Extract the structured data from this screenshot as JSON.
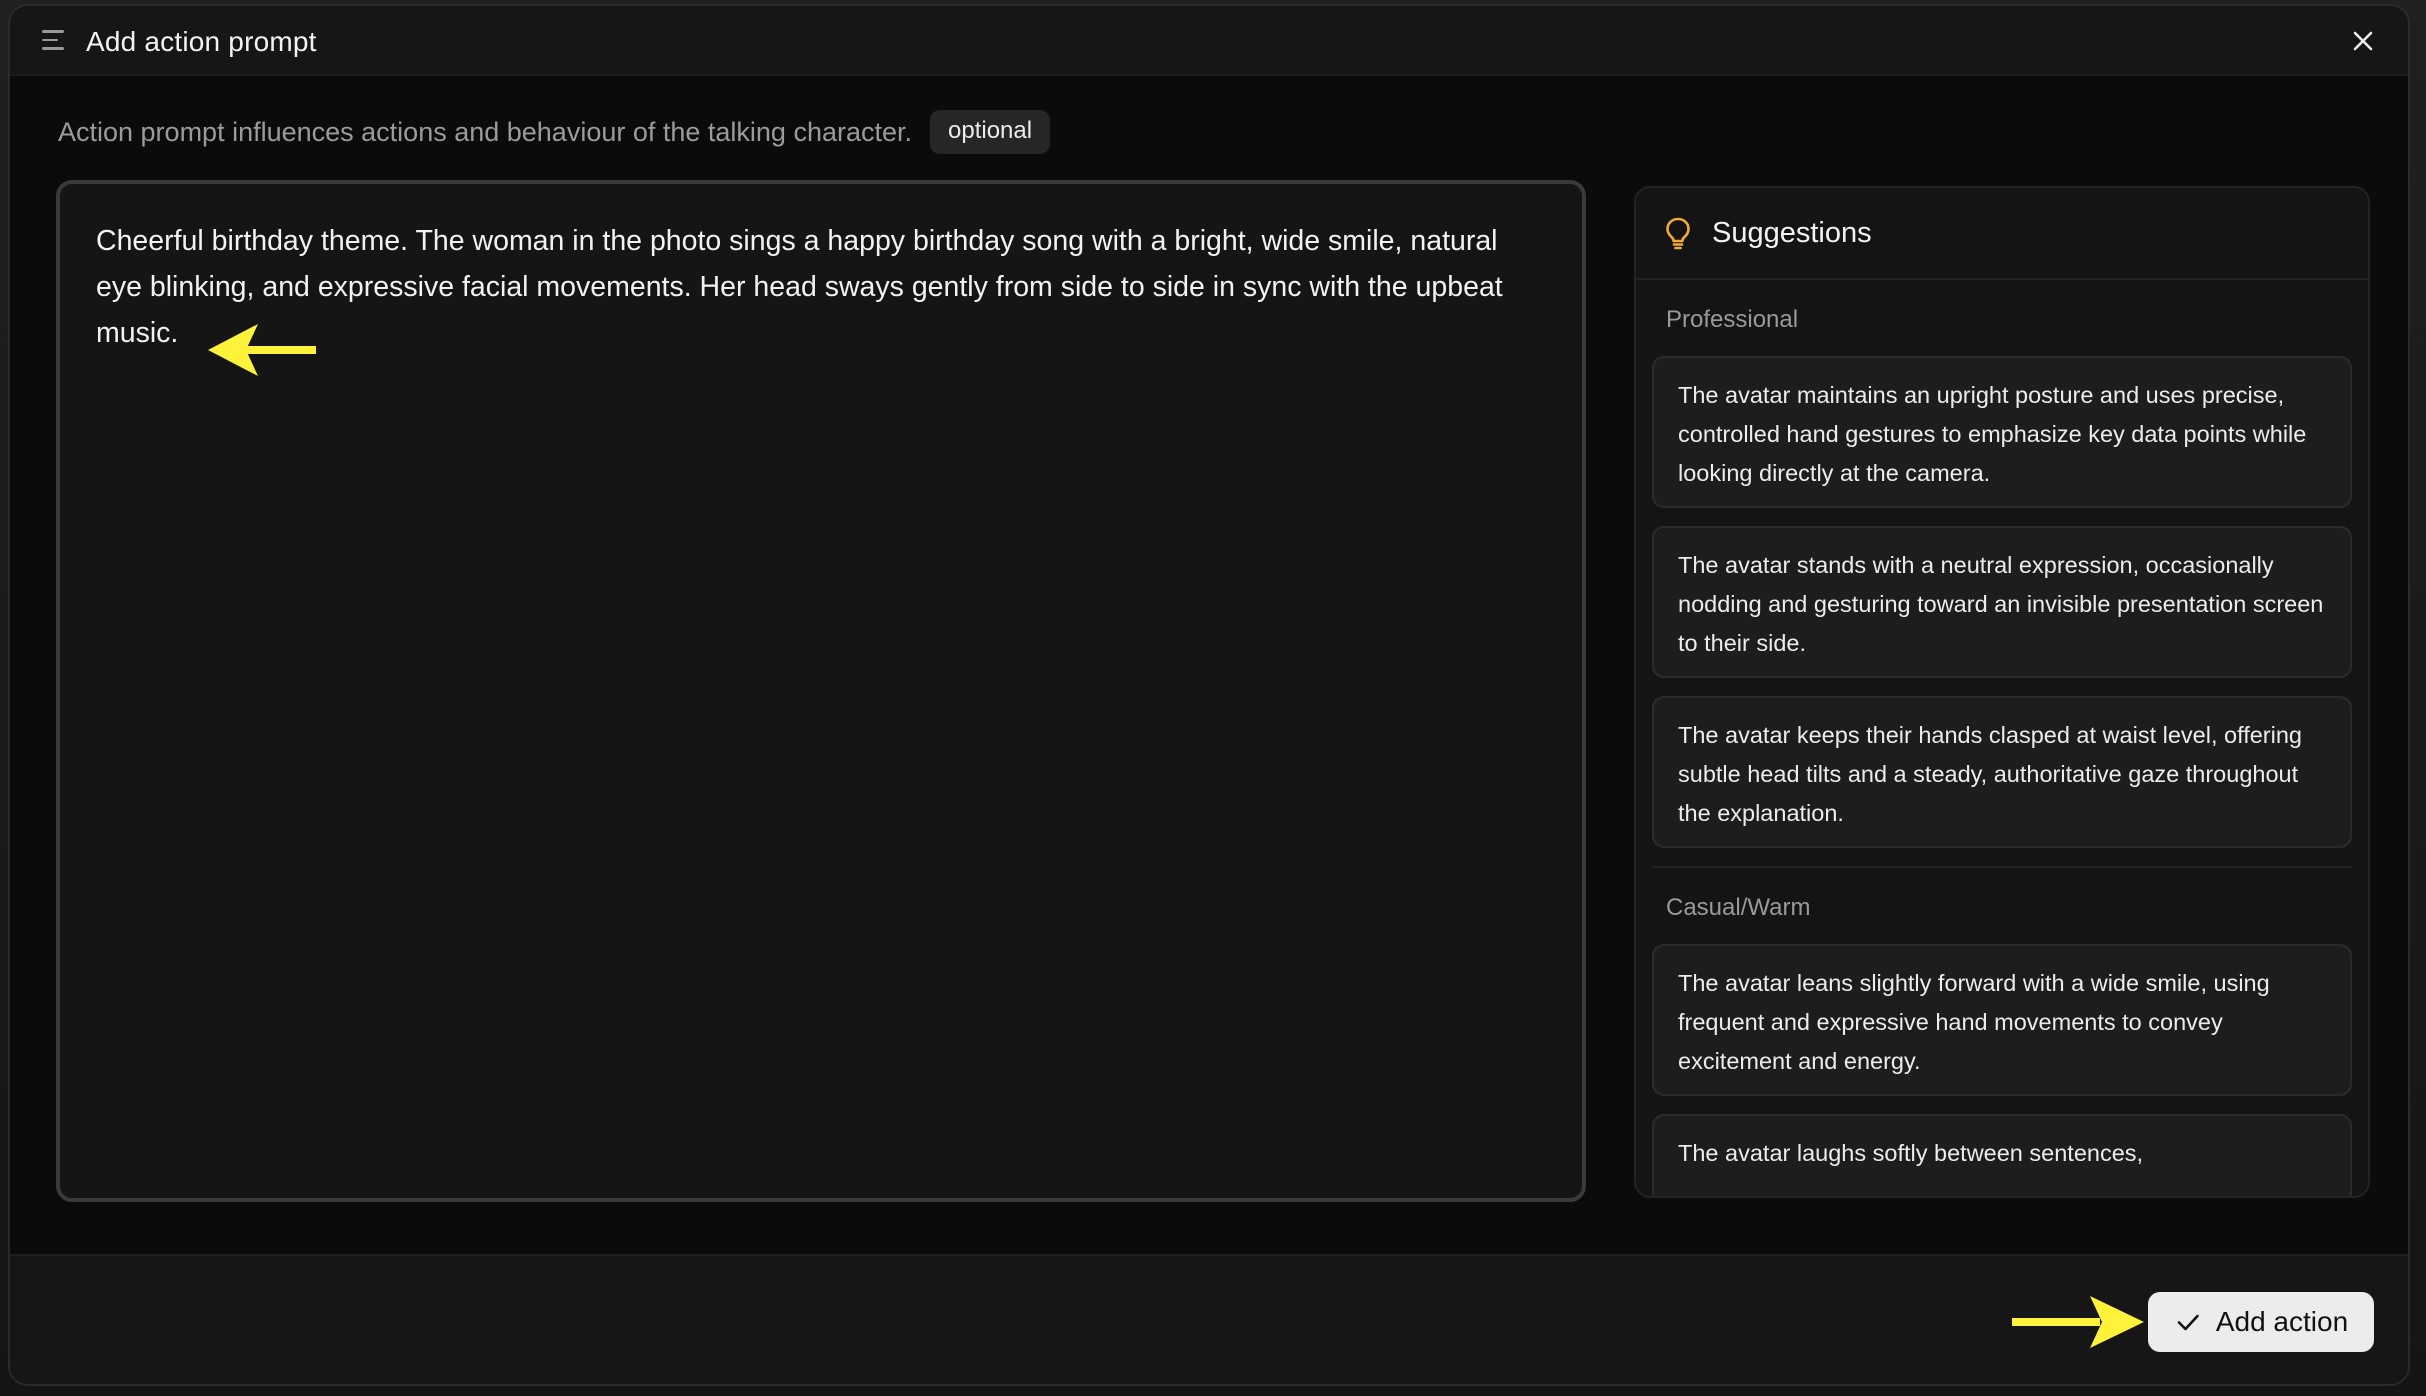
{
  "dialog": {
    "title": "Add action prompt",
    "subtitle": "Action prompt influences actions and behaviour of the talking character.",
    "badge": "optional"
  },
  "editor": {
    "value": "Cheerful birthday theme. The woman in the photo sings a happy birthday song with a bright, wide smile, natural eye blinking, and expressive facial movements. Her head sways gently from side to side in sync with the upbeat music."
  },
  "suggestions": {
    "title": "Suggestions",
    "categories": [
      {
        "label": "Professional",
        "items": [
          "The avatar maintains an upright posture and uses precise, controlled hand gestures to emphasize key data points while looking directly at the camera.",
          "The avatar stands with a neutral expression, occasionally nodding and gesturing toward an invisible presentation screen to their side.",
          "The avatar keeps their hands clasped at waist level, offering subtle head tilts and a steady, authoritative gaze throughout the explanation."
        ]
      },
      {
        "label": "Casual/Warm",
        "items": [
          "The avatar leans slightly forward with a wide smile, using frequent and expressive hand movements to convey excitement and energy.",
          "The avatar laughs softly between sentences,"
        ]
      }
    ]
  },
  "footer": {
    "add_action_label": "Add action"
  },
  "icons": {
    "menu": "menu-icon",
    "close": "close-icon",
    "bulb": "lightbulb-icon",
    "check": "check-icon",
    "annotation_arrow": "arrow-icon"
  },
  "colors": {
    "bulb_accent": "#f2a93b",
    "annotation_arrow": "#fff23a",
    "button_bg": "#ececec"
  }
}
